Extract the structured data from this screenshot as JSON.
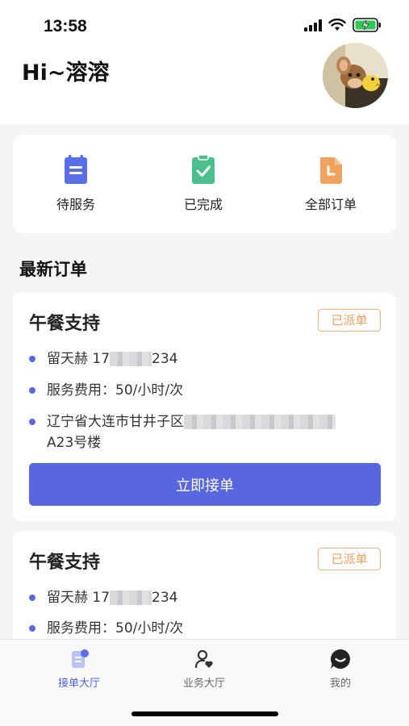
{
  "status_bar": {
    "time": "13:58"
  },
  "header": {
    "greeting": "Hi~溶溶"
  },
  "quick_actions": [
    {
      "label": "待服务",
      "icon": "clipboard-list-icon",
      "color": "#5a6ee6"
    },
    {
      "label": "已完成",
      "icon": "clipboard-check-icon",
      "color": "#4bbf8c"
    },
    {
      "label": "全部订单",
      "icon": "document-clock-icon",
      "color": "#f0a35e"
    }
  ],
  "section": {
    "title": "最新订单"
  },
  "orders": [
    {
      "title": "午餐支持",
      "badge": "已派单",
      "contact_name": "留天赫 17",
      "contact_suffix": "234",
      "fee": "服务费用：50/小时/次",
      "address_prefix": "辽宁省大连市甘井子区",
      "address_line2": "A23号楼",
      "button": "立即接单"
    },
    {
      "title": "午餐支持",
      "badge": "已派单",
      "contact_name": "留天赫 17",
      "contact_suffix": "234",
      "fee": "服务费用：50/小时/次"
    }
  ],
  "tabbar": [
    {
      "label": "接单大厅",
      "icon": "order-hall-icon",
      "active": true
    },
    {
      "label": "业务大厅",
      "icon": "user-heart-icon",
      "active": false
    },
    {
      "label": "我的",
      "icon": "chat-smile-icon",
      "active": false
    }
  ],
  "colors": {
    "accent": "#5867e0",
    "badge": "#ee9f5d",
    "tab_active": "#4a63d9"
  }
}
